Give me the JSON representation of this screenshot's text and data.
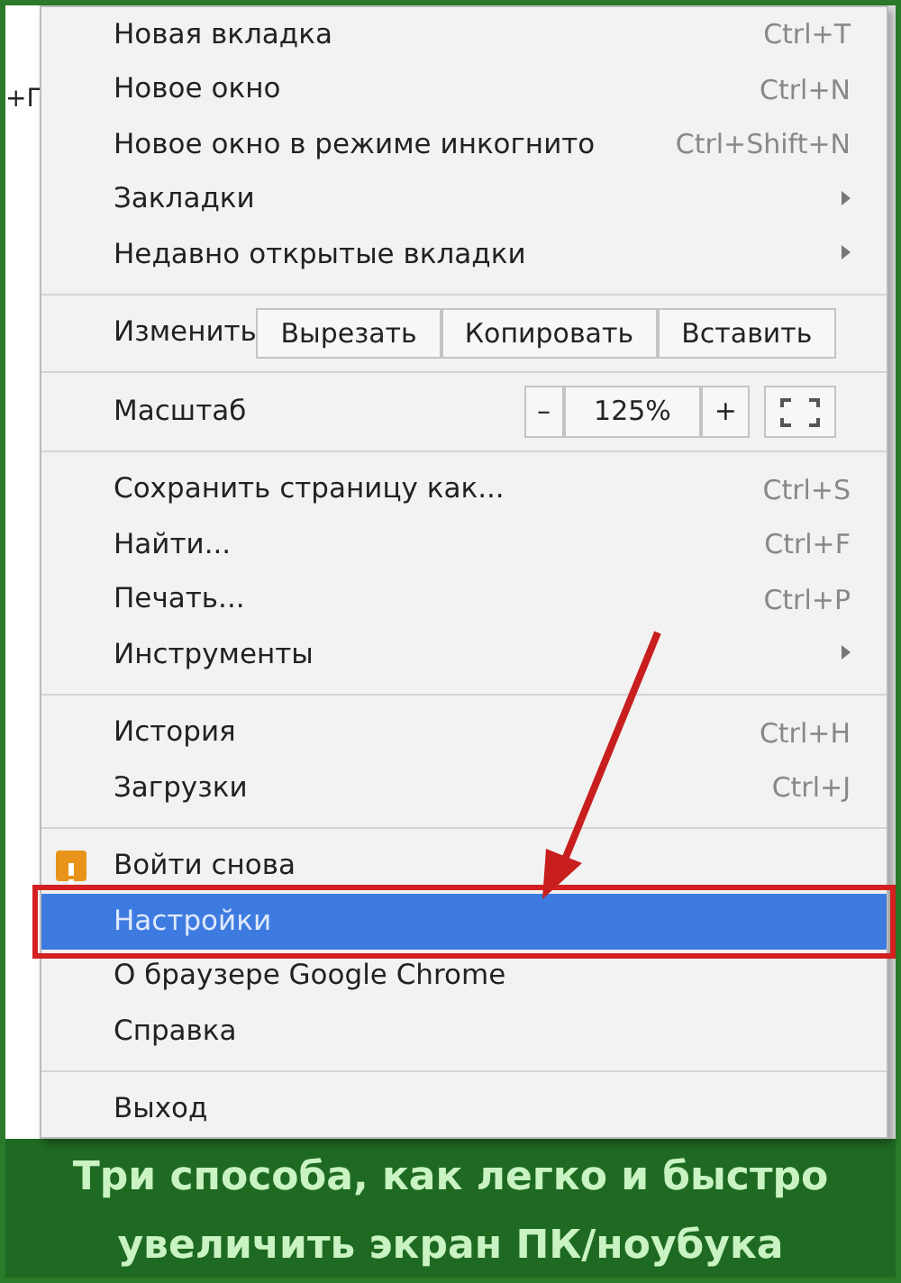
{
  "background_fragment": "+Г",
  "menu": [
    {
      "kind": "item",
      "label": "Новая вкладка",
      "shortcut": "Ctrl+T",
      "submenu": false,
      "selected": false
    },
    {
      "kind": "item",
      "label": "Новое окно",
      "shortcut": "Ctrl+N",
      "submenu": false,
      "selected": false
    },
    {
      "kind": "item",
      "label": "Новое окно в режиме инкогнито",
      "shortcut": "Ctrl+Shift+N",
      "submenu": false,
      "selected": false
    },
    {
      "kind": "item",
      "label": "Закладки",
      "submenu": true,
      "selected": false
    },
    {
      "kind": "item",
      "label": "Недавно открытые вкладки",
      "submenu": true,
      "selected": false
    },
    {
      "kind": "separator"
    },
    {
      "kind": "edit",
      "label": "Изменить",
      "buttons": [
        "Вырезать",
        "Копировать",
        "Вставить"
      ]
    },
    {
      "kind": "separator"
    },
    {
      "kind": "zoom",
      "label": "Масштаб",
      "minus": "–",
      "value": "125%",
      "plus": "+"
    },
    {
      "kind": "separator"
    },
    {
      "kind": "item",
      "label": "Сохранить страницу как...",
      "shortcut": "Ctrl+S",
      "submenu": false,
      "selected": false
    },
    {
      "kind": "item",
      "label": "Найти...",
      "shortcut": "Ctrl+F",
      "submenu": false,
      "selected": false
    },
    {
      "kind": "item",
      "label": "Печать...",
      "shortcut": "Ctrl+P",
      "submenu": false,
      "selected": false
    },
    {
      "kind": "item",
      "label": "Инструменты",
      "submenu": true,
      "selected": false
    },
    {
      "kind": "separator"
    },
    {
      "kind": "item",
      "label": "История",
      "shortcut": "Ctrl+H",
      "submenu": false,
      "selected": false
    },
    {
      "kind": "item",
      "label": "Загрузки",
      "shortcut": "Ctrl+J",
      "submenu": false,
      "selected": false
    },
    {
      "kind": "separator"
    },
    {
      "kind": "item",
      "label": "Войти снова",
      "warning": true,
      "submenu": false,
      "selected": false
    },
    {
      "kind": "item",
      "label": "Настройки",
      "submenu": false,
      "selected": true,
      "highlighted": true
    },
    {
      "kind": "item",
      "label": "О браузере Google Chrome",
      "submenu": false,
      "selected": false
    },
    {
      "kind": "item",
      "label": "Справка",
      "submenu": false,
      "selected": false
    },
    {
      "kind": "separator"
    },
    {
      "kind": "item",
      "label": "Выход",
      "submenu": false,
      "selected": false
    }
  ],
  "caption": [
    "Три способа, как легко и быстро",
    "увеличить экран ПК/ноубука"
  ]
}
